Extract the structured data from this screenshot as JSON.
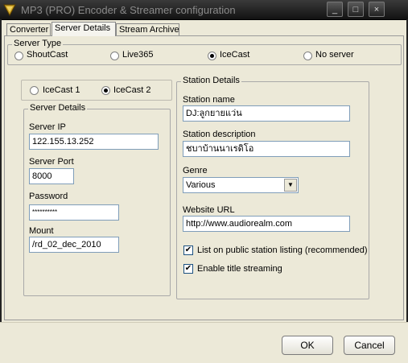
{
  "window": {
    "title": "MP3 (PRO) Encoder & Streamer configuration",
    "controls": {
      "minimize": "_",
      "maximize": "□",
      "close": "×"
    }
  },
  "tabs": [
    {
      "label": "Converter",
      "active": false
    },
    {
      "label": "Server Details",
      "active": true
    },
    {
      "label": "Stream Archive",
      "active": false
    }
  ],
  "server_type": {
    "legend": "Server Type",
    "options": [
      {
        "label": "ShoutCast",
        "selected": false
      },
      {
        "label": "Live365",
        "selected": false
      },
      {
        "label": "IceCast",
        "selected": true
      },
      {
        "label": "No server",
        "selected": false
      }
    ]
  },
  "icecast_version": {
    "options": [
      {
        "label": "IceCast 1",
        "selected": false
      },
      {
        "label": "IceCast 2",
        "selected": true
      }
    ]
  },
  "server_details": {
    "legend": "Server Details",
    "ip_label": "Server IP",
    "ip_value": "122.155.13.252",
    "port_label": "Server Port",
    "port_value": "8000",
    "password_label": "Password",
    "password_value": "**********",
    "mount_label": "Mount",
    "mount_value": "/rd_02_dec_2010"
  },
  "station_details": {
    "legend": "Station Details",
    "name_label": "Station name",
    "name_value": "DJ:ลูกยายแว่น",
    "desc_label": "Station description",
    "desc_value": "ชบาบ้านนาเรดิโอ",
    "genre_label": "Genre",
    "genre_value": "Various",
    "url_label": "Website URL",
    "url_value": "http://www.audiorealm.com",
    "list_public_label": "List on public station listing (recommended)",
    "list_public_checked": true,
    "title_streaming_label": "Enable title streaming",
    "title_streaming_checked": true
  },
  "footer": {
    "ok_label": "OK",
    "cancel_label": "Cancel"
  }
}
